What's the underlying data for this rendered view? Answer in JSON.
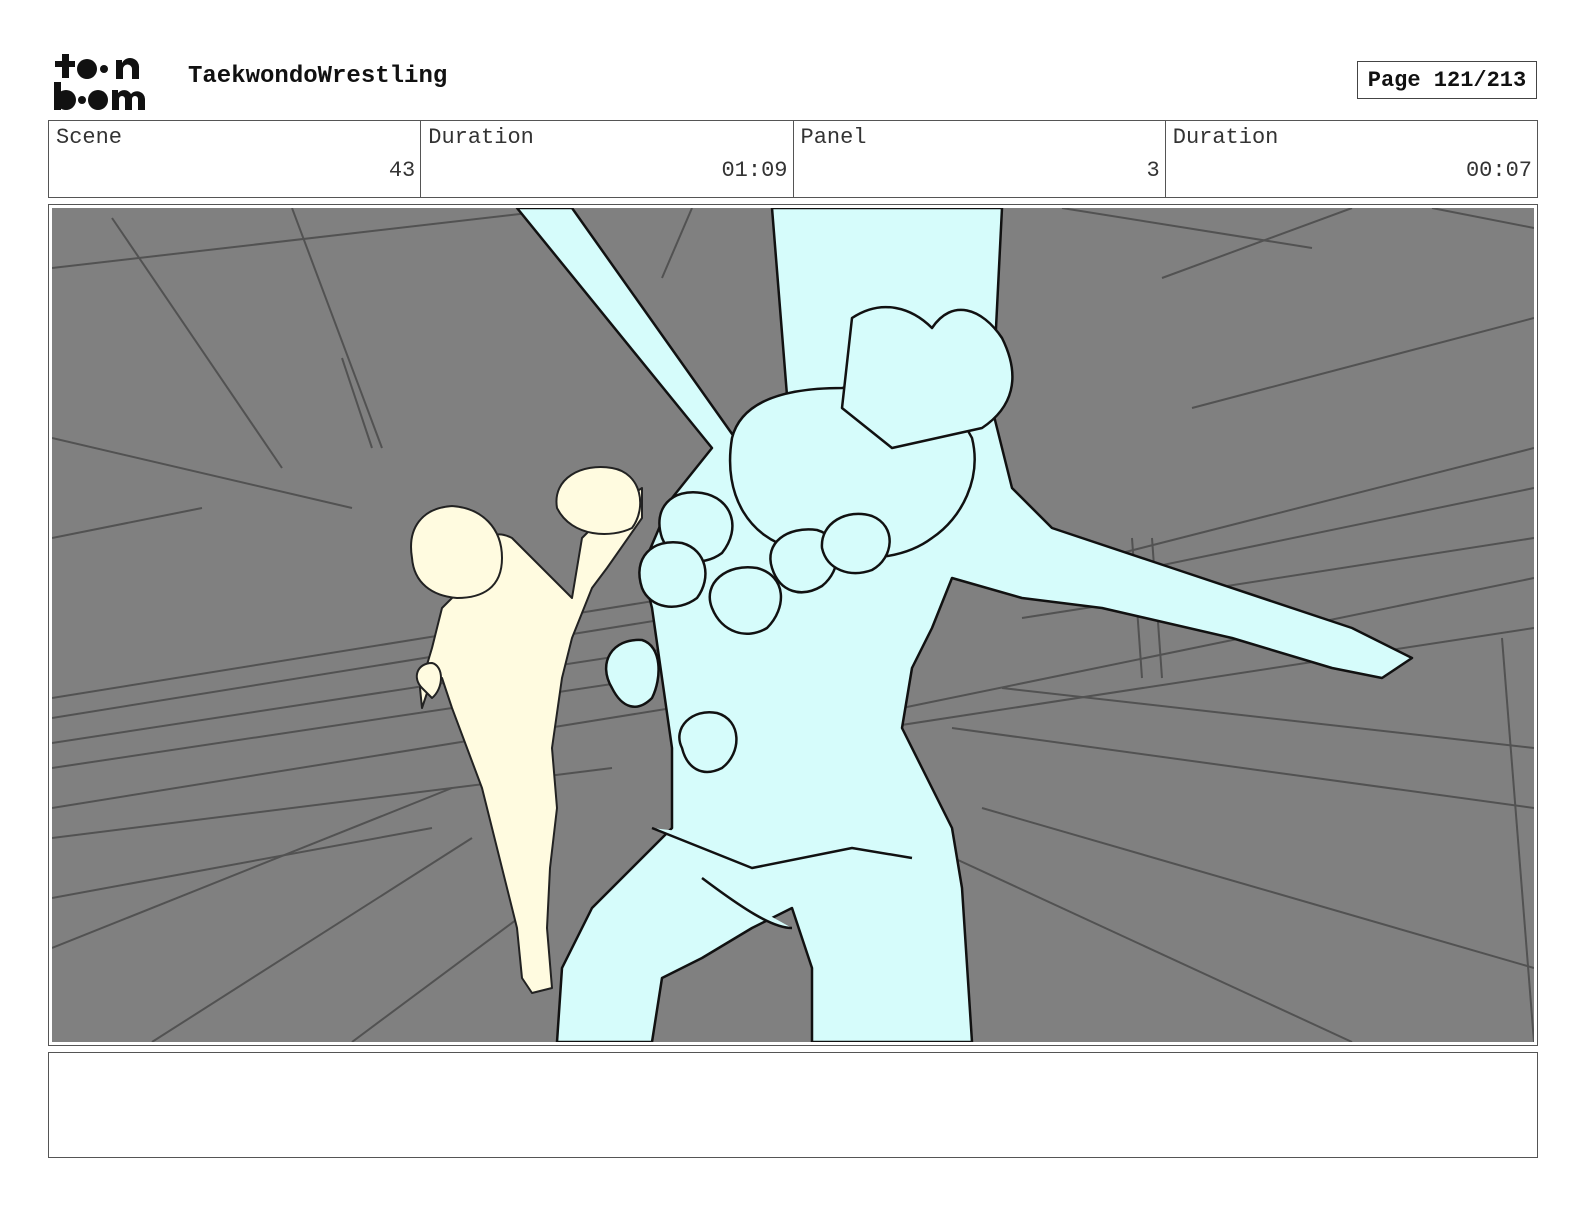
{
  "header": {
    "logo_text": "toon boom",
    "project_title": "TaekwondoWrestling",
    "page_label": "Page 121/213"
  },
  "info": {
    "scene_label": "Scene",
    "scene_value": "43",
    "scene_duration_label": "Duration",
    "scene_duration_value": "01:09",
    "panel_label": "Panel",
    "panel_value": "3",
    "panel_duration_label": "Duration",
    "panel_duration_value": "00:07"
  },
  "colors": {
    "background_gray": "#808080",
    "character_cyan": "#d6fcfb",
    "character_cream": "#fffbe0",
    "line_art": "#111111"
  },
  "notes": {
    "text": ""
  }
}
